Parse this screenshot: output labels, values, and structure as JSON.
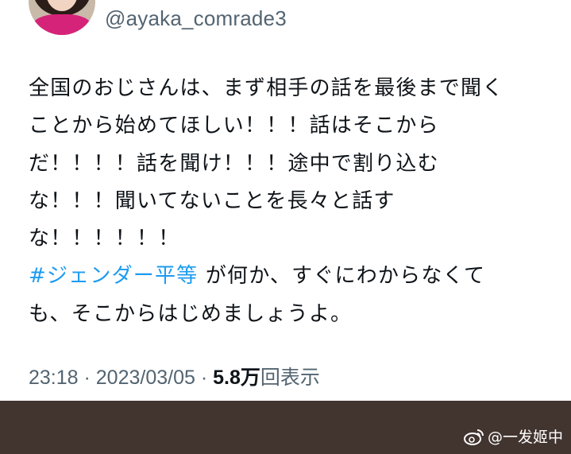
{
  "tweet": {
    "handle": "@ayaka_comrade3",
    "lines": [
      "全国のおじさんは、まず相手の話を最後まで聞く",
      "ことから始めてほしい！！！話はそこから",
      "だ！！！！話を聞け！！！途中で割り込む",
      "な！！！聞いてないことを長々と話す",
      "な！！！！！！"
    ],
    "hashtag": "#ジェンダー平等",
    "after_hashtag": " が何か、すぐにわからなくて",
    "last_line": "も、そこからはじめましょうよ。",
    "time": "23:18",
    "separator": " · ",
    "date": "2023/03/05",
    "views_count": "5.8万",
    "views_label": "回表示"
  },
  "watermark": {
    "text": "@一发姬中",
    "logo_icon": "weibo-logo-icon"
  },
  "colors": {
    "hashtag": "#1d9bf0",
    "meta": "#536471",
    "bar": "#42342f"
  }
}
